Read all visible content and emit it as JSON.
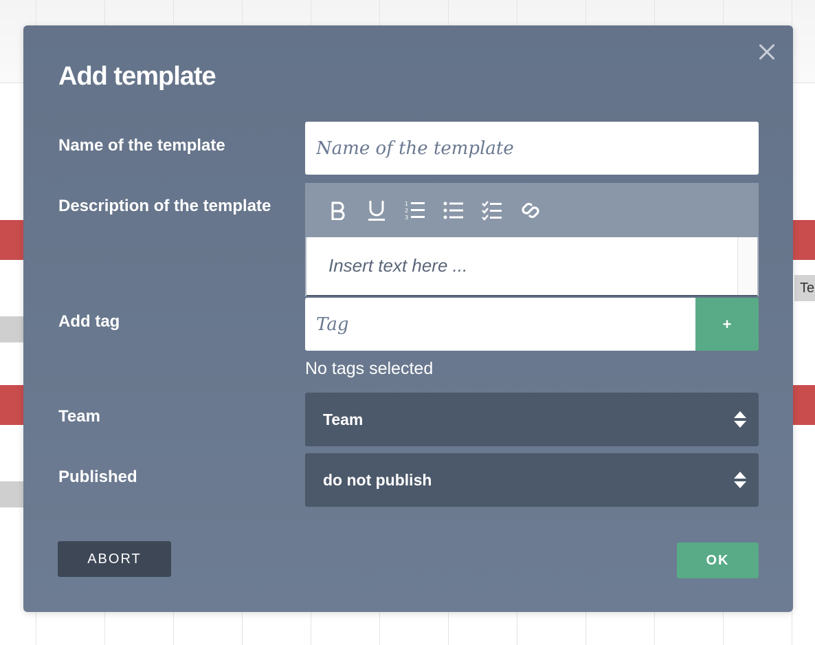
{
  "background": {
    "side_tag_text": "Te"
  },
  "modal": {
    "title": "Add template",
    "close_icon": "close-icon",
    "fields": {
      "name": {
        "label": "Name of the template",
        "placeholder": "Name of the template",
        "value": ""
      },
      "description": {
        "label": "Description of the template",
        "placeholder": "Insert text here ...",
        "toolbar": [
          "bold-icon",
          "underline-icon",
          "ordered-list-icon",
          "bullet-list-icon",
          "checklist-icon",
          "link-icon"
        ]
      },
      "tag": {
        "label": "Add tag",
        "placeholder": "Tag",
        "add_label": "+",
        "empty_text": "No tags selected"
      },
      "team": {
        "label": "Team",
        "selected": "Team"
      },
      "published": {
        "label": "Published",
        "selected": "do not publish"
      }
    },
    "buttons": {
      "abort": "ABORT",
      "ok": "OK"
    }
  },
  "colors": {
    "modal_bg": "#647389",
    "toolbar_bg": "#8a97a8",
    "select_bg": "#4c596a",
    "accent_green": "#58ab86",
    "abort_bg": "#3d4756",
    "band_red": "#c94d4d"
  }
}
